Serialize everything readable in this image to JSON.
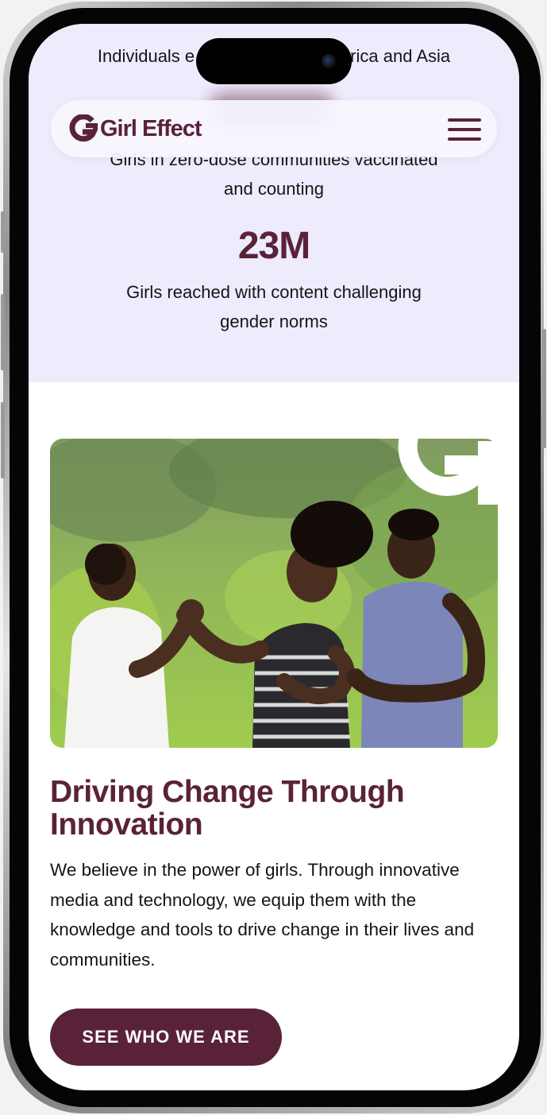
{
  "header": {
    "logo_text": "Girl Effect",
    "menu_icon": "hamburger-menu-icon"
  },
  "stats": {
    "line1_left": "Individuals e",
    "line1_right": "rica and Asia",
    "partial_text": "Girls in zero-dose communities vaccinated",
    "partial_text_line2": "and counting",
    "big_value": "23M",
    "desc_line1": "Girls reached with content challenging",
    "desc_line2": "gender norms"
  },
  "content": {
    "image_alt": "Three smiling young women outdoors, two shaking hands",
    "headline_line1": "Driving Change Through",
    "headline_line2": "Innovation",
    "body": "We believe in the power of girls. Through innovative media and technology, we equip them with the knowledge and tools to drive change in their lives and communities.",
    "cta_label": "SEE WHO WE ARE"
  },
  "colors": {
    "brand": "#5a2238",
    "stats_bg": "#eeebfc",
    "text": "#1a1218"
  }
}
